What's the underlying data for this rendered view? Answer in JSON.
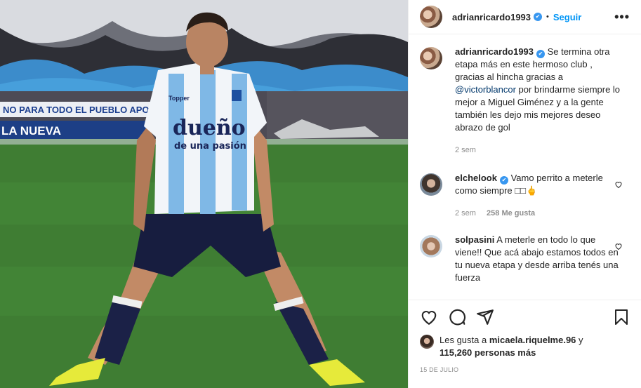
{
  "post": {
    "username": "adrianricardo1993",
    "verified_mark": "✔",
    "separator": "•",
    "follow_label": "Seguir",
    "more_label": "•••"
  },
  "photo": {
    "banner_text": "NO PARA TODO EL PUEBLO APOSE",
    "banner_text2": "LA NUEVA",
    "jersey_text1": "dueño",
    "jersey_text2": "de una pasión",
    "sponsor": "Topper"
  },
  "caption": {
    "username": "adrianricardo1993",
    "text_before": "Se termina otra etapa más en este hermoso club , gracias al hincha gracias a",
    "mention": "@victorblancor",
    "text_after": "por brindarme siempre lo mejor a Miguel Giménez y a la gente también les dejo mis mejores deseo abrazo de gol",
    "time": "2 sem"
  },
  "comments": [
    {
      "username": "elchelook",
      "text": "Vamo perrito a meterle como siempre □□🖕",
      "time": "2 sem",
      "likes": "258 Me gusta"
    },
    {
      "username": "solpasini",
      "text": "A meterle en todo lo que viene!! Que acá abajo estamos todos en tu nueva etapa y desde arriba tenés una fuerza"
    }
  ],
  "footer": {
    "likes_prefix": "Les gusta a",
    "liker": "micaela.riquelme.96",
    "likes_mid": "y",
    "likes_count": "115,260 personas más",
    "date": "15 DE JULIO"
  },
  "icons": {
    "like": "heart-icon",
    "comment": "comment-icon",
    "share": "share-icon",
    "save": "bookmark-icon",
    "verified": "verified-badge-icon"
  },
  "colors": {
    "link_blue": "#0095f6",
    "mention_blue": "#00376b",
    "muted": "#8e8e8e",
    "verified": "#3897f0"
  }
}
